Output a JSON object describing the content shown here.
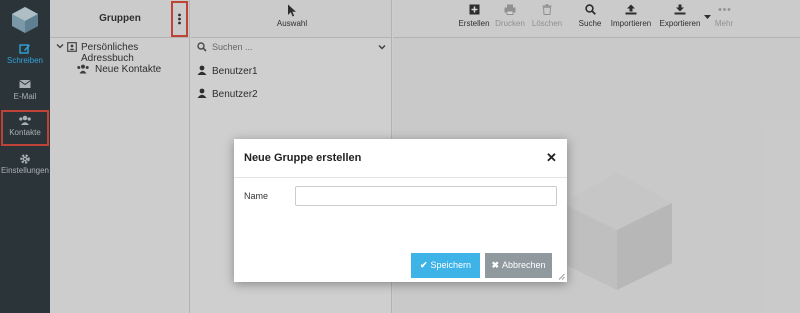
{
  "nav": {
    "items": [
      {
        "label": "Schreiben",
        "icon": "compose-icon"
      },
      {
        "label": "E-Mail",
        "icon": "mail-icon"
      },
      {
        "label": "Kontakte",
        "icon": "contacts-icon"
      },
      {
        "label": "Einstellungen",
        "icon": "gear-icon"
      }
    ]
  },
  "groups": {
    "title": "Gruppen",
    "tree": [
      {
        "label": "Persönliches Adressbuch"
      },
      {
        "label": "Neue Kontakte"
      }
    ]
  },
  "list": {
    "toolbar_label": "Auswahl",
    "search_placeholder": "Suchen ...",
    "users": [
      "Benutzer1",
      "Benutzer2"
    ]
  },
  "toolbar": {
    "create": "Erstellen",
    "print": "Drucken",
    "delete": "Löschen",
    "search": "Suche",
    "import": "Importieren",
    "export": "Exportieren",
    "more": "Mehr"
  },
  "dialog": {
    "title": "Neue Gruppe erstellen",
    "name_label": "Name",
    "name_value": "",
    "save_label": "Speichern",
    "cancel_label": "Abbrechen"
  },
  "colors": {
    "accent": "#37c0ff",
    "save_button": "#3db3e8",
    "cancel_button": "#8f999e",
    "highlight": "#e24b3b",
    "nav_bg": "#2f3a40"
  }
}
